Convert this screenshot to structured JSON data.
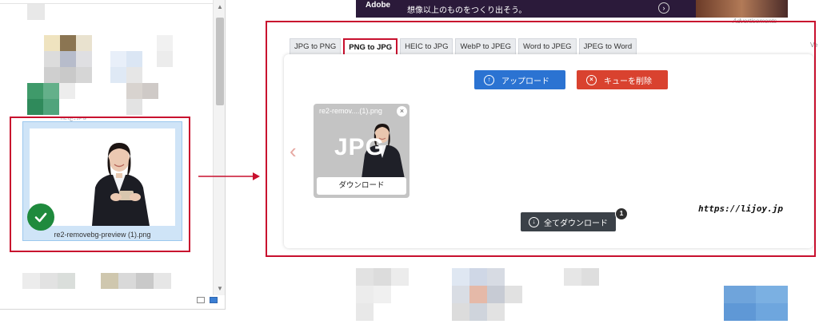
{
  "colors": {
    "highlight_red": "#c8102e",
    "upload_blue": "#2b73d2",
    "clear_red": "#d9422f",
    "download_dark": "#3b4148",
    "selection_blue": "#cfe4f7",
    "check_green": "#1f8a3d"
  },
  "explorer": {
    "selected_file_name": "re2-removebg-preview (1).png",
    "icons": [
      "check-circle-icon",
      "scroll-up-icon",
      "scroll-down-icon",
      "details-view-icon",
      "large-icons-view-icon"
    ]
  },
  "ad": {
    "brand": "Adobe",
    "text": "想像以上のものをつくり出そう。",
    "label": "Advertisements"
  },
  "converter": {
    "tabs": [
      {
        "label": "JPG to PNG"
      },
      {
        "label": "PNG to JPG"
      },
      {
        "label": "HEIC to JPG"
      },
      {
        "label": "WebP to JPEG"
      },
      {
        "label": "Word to JPEG"
      },
      {
        "label": "JPEG to Word"
      }
    ],
    "active_tab": "PNG to JPG",
    "upload_label": "アップロード",
    "clear_label": "キューを削除",
    "file_card": {
      "file_name": "re2-remov....(1).png",
      "format": "JPG",
      "download_label": "ダウンロード"
    },
    "download_all_label": "全てダウンロード",
    "queue_count": "1",
    "watermark": "https://lijoy.jp"
  }
}
